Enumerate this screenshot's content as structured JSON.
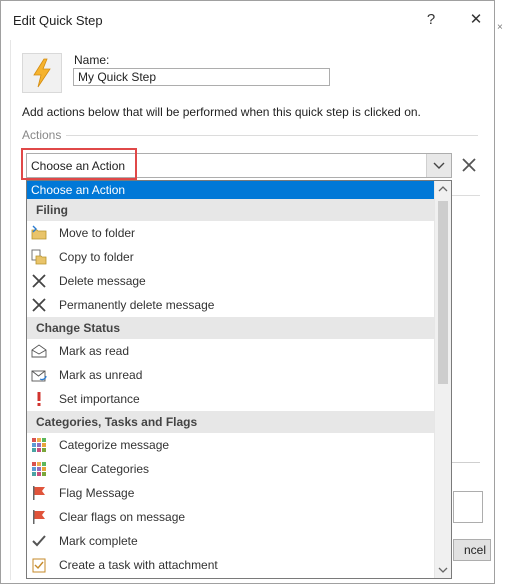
{
  "dialog": {
    "title": "Edit Quick Step",
    "help_glyph": "?",
    "close_glyph": "✕"
  },
  "form": {
    "name_label": "Name:",
    "name_value": "My Quick Step",
    "instructions": "Add actions below that will be performed when this quick step is clicked on.",
    "actions_label": "Actions",
    "combo_value": "Choose an Action",
    "remove_glyph": "✕"
  },
  "dropdown": {
    "selected": "Choose an Action",
    "groups": [
      {
        "header": "Filing",
        "items": [
          {
            "label": "Move to folder",
            "icon": "move-folder-icon"
          },
          {
            "label": "Copy to folder",
            "icon": "copy-folder-icon"
          },
          {
            "label": "Delete message",
            "icon": "delete-x-icon"
          },
          {
            "label": "Permanently delete message",
            "icon": "delete-x-icon"
          }
        ]
      },
      {
        "header": "Change Status",
        "items": [
          {
            "label": "Mark as read",
            "icon": "envelope-open-icon"
          },
          {
            "label": "Mark as unread",
            "icon": "envelope-unread-icon"
          },
          {
            "label": "Set importance",
            "icon": "exclamation-icon"
          }
        ]
      },
      {
        "header": "Categories, Tasks and Flags",
        "items": [
          {
            "label": "Categorize message",
            "icon": "category-grid-icon"
          },
          {
            "label": "Clear Categories",
            "icon": "category-grid-icon"
          },
          {
            "label": "Flag Message",
            "icon": "flag-icon"
          },
          {
            "label": "Clear flags on message",
            "icon": "flag-icon"
          },
          {
            "label": "Mark complete",
            "icon": "checkmark-icon"
          },
          {
            "label": "Create a task with attachment",
            "icon": "task-icon"
          }
        ]
      }
    ]
  },
  "footer": {
    "cancel_label": "ncel"
  },
  "colors": {
    "selection": "#0078d7",
    "highlight_box": "#e04848",
    "header_bg": "#e7e7e7"
  }
}
